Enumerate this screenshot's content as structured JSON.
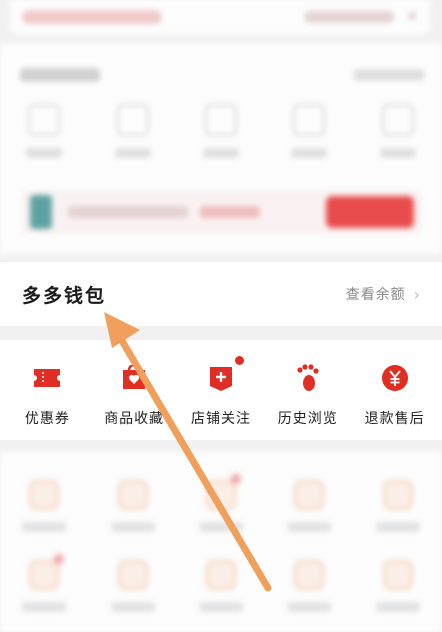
{
  "wallet": {
    "title": "多多钱包",
    "balance_link": "查看余额",
    "chevron": "›"
  },
  "shortcuts": [
    {
      "label": "优惠券",
      "icon": "coupon-icon"
    },
    {
      "label": "商品收藏",
      "icon": "favorite-goods-icon"
    },
    {
      "label": "店铺关注",
      "icon": "store-follow-icon",
      "badge": true
    },
    {
      "label": "历史浏览",
      "icon": "footprint-icon"
    },
    {
      "label": "退款售后",
      "icon": "refund-icon"
    }
  ],
  "colors": {
    "accent_red": "#e02e24",
    "annotation_arrow": "#f0a05c"
  }
}
